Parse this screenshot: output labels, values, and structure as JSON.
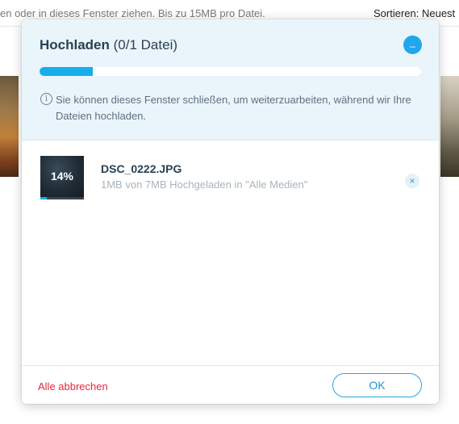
{
  "background": {
    "hint_text": "en oder in dieses Fenster ziehen. Bis zu 15MB pro Datei.",
    "sort_label": "Sortieren: Neuest"
  },
  "dialog": {
    "title_main": "Hochladen",
    "title_count": "(0/1 Datei)",
    "minimize_glyph": "_",
    "overall_progress": 0.14,
    "info_text": "Sie können dieses Fenster schließen, um weiterzuarbeiten, während wir Ihre Dateien hochladen.",
    "files": [
      {
        "progress_label": "14%",
        "progress": 0.14,
        "name": "DSC_0222.JPG",
        "status": "1MB von 7MB Hochgeladen in \"Alle Medien\"",
        "remove_glyph": "×"
      }
    ],
    "cancel_all_label": "Alle abbrechen",
    "ok_label": "OK"
  },
  "colors": {
    "accent": "#16aeea",
    "header_bg": "#eaf4fb",
    "danger": "#e22a3b",
    "title": "#2a4153"
  },
  "icons": {
    "info": "info-icon",
    "minimize": "minimize-icon",
    "remove": "close-icon"
  }
}
